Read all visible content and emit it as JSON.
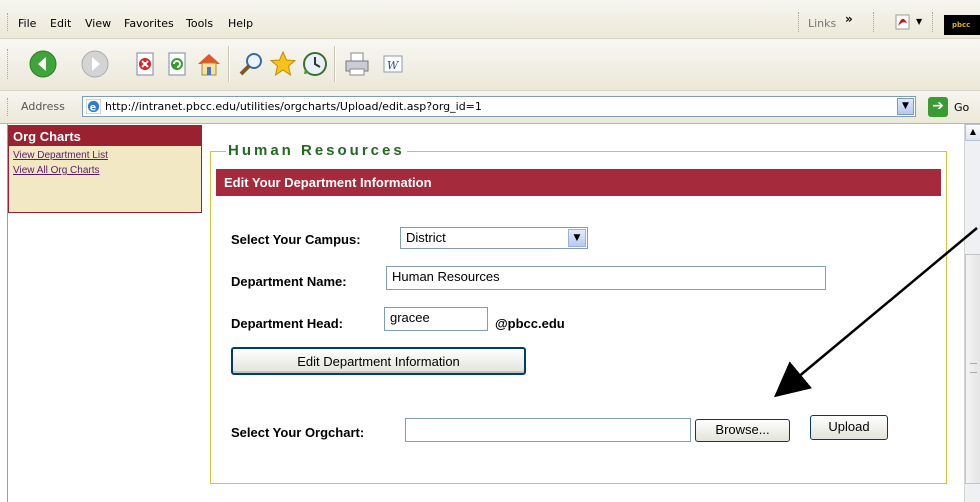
{
  "menu": {
    "items": [
      "File",
      "Edit",
      "View",
      "Favorites",
      "Tools",
      "Help"
    ],
    "links_label": "Links",
    "links_chevron": "»",
    "logo_text": "pbcc"
  },
  "toolbar": {
    "icons": [
      "back-icon",
      "forward-icon",
      "stop-icon",
      "refresh-icon",
      "home-icon",
      "search-icon",
      "favorites-icon",
      "history-icon",
      "print-icon",
      "edit-icon"
    ]
  },
  "address": {
    "label": "Address",
    "url": "http://intranet.pbcc.edu/utilities/orgcharts/Upload/edit.asp?org_id=1",
    "go_label": "Go"
  },
  "sidebar": {
    "title": "Org Charts",
    "links": [
      "View Department List",
      "View All Org Charts"
    ]
  },
  "form": {
    "legend": "Human Resources",
    "header": "Edit Your Department Information",
    "campus_label": "Select Your Campus:",
    "campus_value": "District",
    "dept_name_label": "Department Name:",
    "dept_name_value": "Human Resources",
    "dept_head_label": "Department Head:",
    "dept_head_value": "gracee",
    "email_suffix": "@pbcc.edu",
    "edit_button": "Edit Department Information",
    "orgchart_label": "Select Your Orgchart:",
    "orgchart_value": "",
    "browse_button": "Browse...",
    "upload_button": "Upload"
  },
  "colors": {
    "accent_red": "#a52a3c",
    "legend_green": "#226a22",
    "sidebar_bg": "#f3e8c4",
    "fieldset_border": "#d7c23a"
  }
}
